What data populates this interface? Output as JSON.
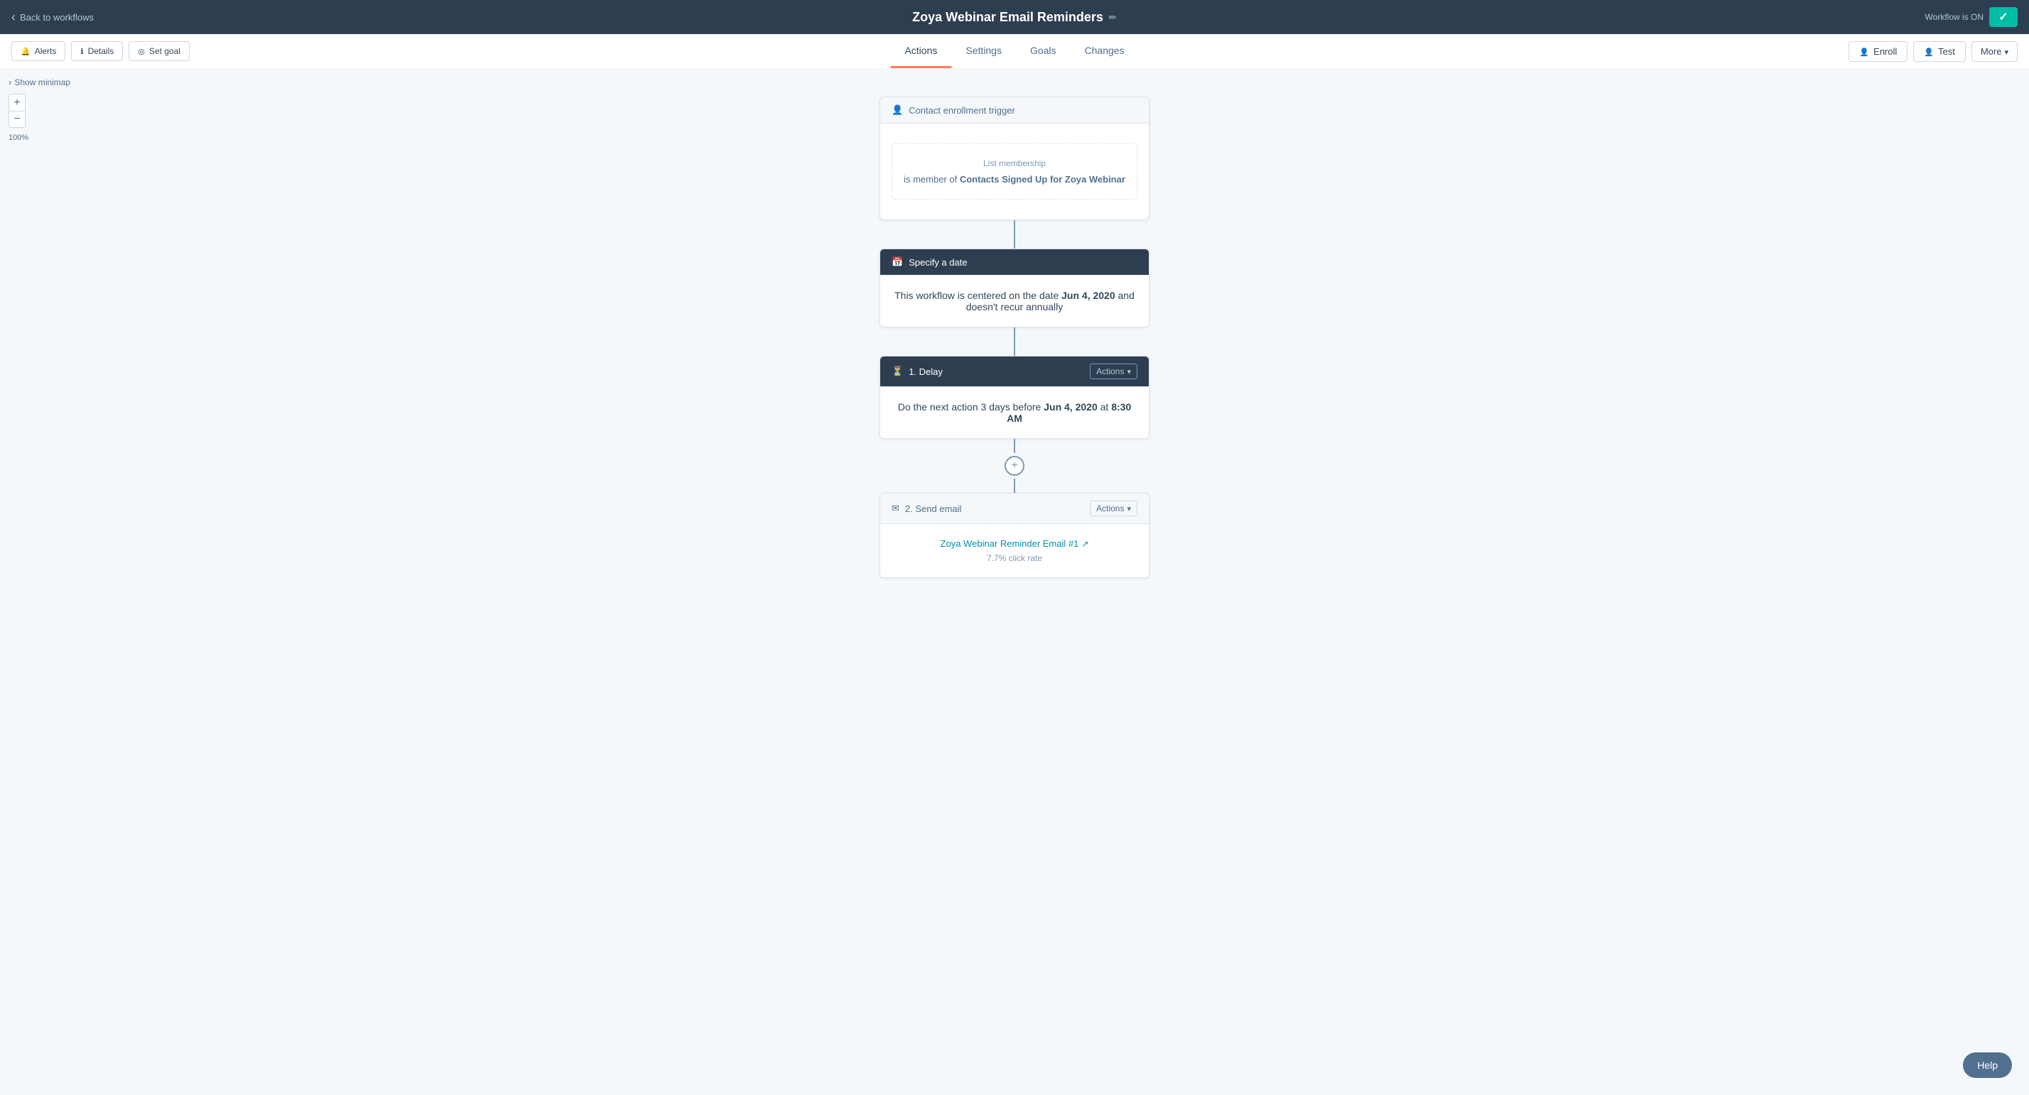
{
  "header": {
    "back_label": "Back to workflows",
    "title": "Zoya Webinar Email Reminders",
    "workflow_status": "Workflow is ON"
  },
  "sub_nav": {
    "alerts_label": "Alerts",
    "details_label": "Details",
    "set_goal_label": "Set goal",
    "enroll_label": "Enroll",
    "test_label": "Test",
    "more_label": "More",
    "tabs": [
      {
        "id": "actions",
        "label": "Actions",
        "active": true
      },
      {
        "id": "settings",
        "label": "Settings",
        "active": false
      },
      {
        "id": "goals",
        "label": "Goals",
        "active": false
      },
      {
        "id": "changes",
        "label": "Changes",
        "active": false
      }
    ]
  },
  "canvas": {
    "minimap_label": "Show minimap",
    "zoom_in_label": "+",
    "zoom_out_label": "−",
    "zoom_level": "100%"
  },
  "enrollment_trigger": {
    "header_label": "Contact enrollment trigger",
    "list_membership_label": "List membership",
    "list_membership_text": "is member of",
    "list_membership_bold": "Contacts Signed Up for Zoya Webinar"
  },
  "specify_date": {
    "header_label": "Specify a date",
    "body_text_before": "This workflow is centered on the date",
    "date_bold": "Jun 4, 2020",
    "body_text_after": "and doesn't recur annually"
  },
  "delay": {
    "header_label": "1. Delay",
    "actions_label": "Actions",
    "body_text_before": "Do the next action 3 days before",
    "date_bold": "Jun 4, 2020",
    "time_text": "at",
    "time_bold": "8:30 AM"
  },
  "send_email": {
    "header_label": "2. Send email",
    "actions_label": "Actions",
    "email_link_text": "Zoya Webinar Reminder Email #1",
    "click_rate": "7.7% click rate"
  },
  "help_label": "Help"
}
